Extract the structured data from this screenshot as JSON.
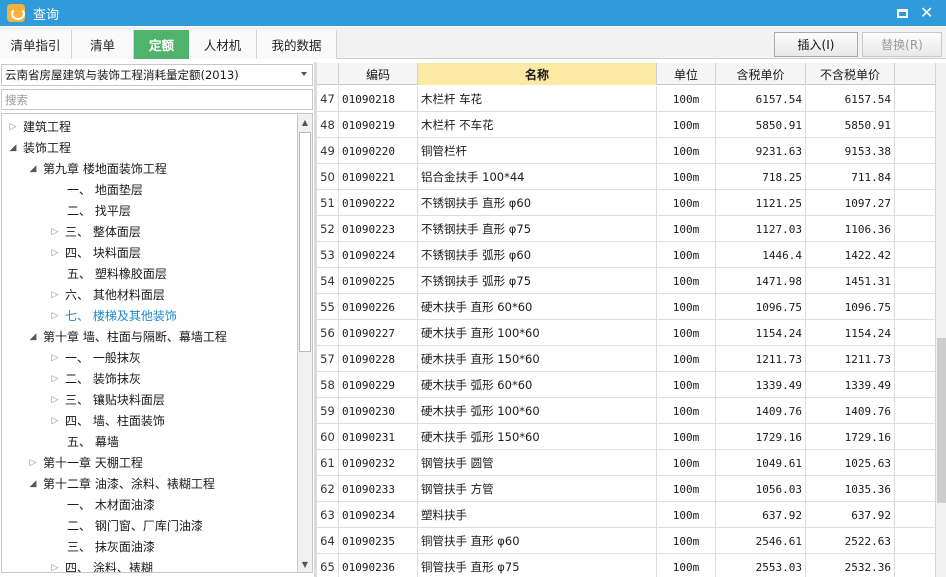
{
  "window": {
    "title": "查询",
    "icon": "app-logo-icon",
    "accent": "#2f9bdb"
  },
  "tabs": [
    {
      "label": "清单指引",
      "active": false
    },
    {
      "label": "清单",
      "active": false
    },
    {
      "label": "定额",
      "active": true
    },
    {
      "label": "人材机",
      "active": false
    },
    {
      "label": "我的数据",
      "active": false
    }
  ],
  "actions": {
    "insert_label": "插入(I)",
    "replace_label": "替换(R)"
  },
  "left": {
    "dropdown_value": "云南省房屋建筑与装饰工程消耗量定额(2013)",
    "search_placeholder": "搜索",
    "tree": [
      {
        "label": "建筑工程",
        "level": 0,
        "caret": "collapsed"
      },
      {
        "label": "装饰工程",
        "level": 0,
        "caret": "expanded"
      },
      {
        "label": "第九章 楼地面装饰工程",
        "level": 1,
        "caret": "expanded"
      },
      {
        "label": "一、 地面垫层",
        "level": 2,
        "caret": "none"
      },
      {
        "label": "二、 找平层",
        "level": 2,
        "caret": "none"
      },
      {
        "label": "三、 整体面层",
        "level": 2,
        "caret": "collapsed"
      },
      {
        "label": "四、 块料面层",
        "level": 2,
        "caret": "collapsed"
      },
      {
        "label": "五、 塑料橡胶面层",
        "level": 2,
        "caret": "none"
      },
      {
        "label": "六、 其他材料面层",
        "level": 2,
        "caret": "collapsed"
      },
      {
        "label": "七、 楼梯及其他装饰",
        "level": 2,
        "caret": "collapsed",
        "selected": true
      },
      {
        "label": "第十章 墙、柱面与隔断、幕墙工程",
        "level": 1,
        "caret": "expanded"
      },
      {
        "label": "一、 一般抹灰",
        "level": 2,
        "caret": "collapsed"
      },
      {
        "label": "二、 装饰抹灰",
        "level": 2,
        "caret": "collapsed"
      },
      {
        "label": "三、 镶贴块料面层",
        "level": 2,
        "caret": "collapsed"
      },
      {
        "label": "四、 墙、柱面装饰",
        "level": 2,
        "caret": "collapsed"
      },
      {
        "label": "五、 幕墙",
        "level": 2,
        "caret": "none"
      },
      {
        "label": "第十一章 天棚工程",
        "level": 1,
        "caret": "collapsed"
      },
      {
        "label": "第十二章 油漆、涂料、裱糊工程",
        "level": 1,
        "caret": "expanded"
      },
      {
        "label": "一、 木材面油漆",
        "level": 2,
        "caret": "none"
      },
      {
        "label": "二、 钢门窗、厂库门油漆",
        "level": 2,
        "caret": "none"
      },
      {
        "label": "三、 抹灰面油漆",
        "level": 2,
        "caret": "none"
      },
      {
        "label": "四、 涂料、裱糊",
        "level": 2,
        "caret": "collapsed"
      }
    ]
  },
  "grid": {
    "headers": {
      "code": "编码",
      "name": "名称",
      "unit": "单位",
      "tax_price": "含税单价",
      "notax_price": "不含税单价"
    },
    "rows": [
      {
        "idx": "47",
        "code": "01090218",
        "name": "木栏杆 车花",
        "unit": "100m",
        "tax": "6157.54",
        "notax": "6157.54"
      },
      {
        "idx": "48",
        "code": "01090219",
        "name": "木栏杆 不车花",
        "unit": "100m",
        "tax": "5850.91",
        "notax": "5850.91"
      },
      {
        "idx": "49",
        "code": "01090220",
        "name": "铜管栏杆",
        "unit": "100m",
        "tax": "9231.63",
        "notax": "9153.38"
      },
      {
        "idx": "50",
        "code": "01090221",
        "name": "铝合金扶手 100*44",
        "unit": "100m",
        "tax": "718.25",
        "notax": "711.84"
      },
      {
        "idx": "51",
        "code": "01090222",
        "name": "不锈钢扶手 直形 φ60",
        "unit": "100m",
        "tax": "1121.25",
        "notax": "1097.27"
      },
      {
        "idx": "52",
        "code": "01090223",
        "name": "不锈钢扶手 直形 φ75",
        "unit": "100m",
        "tax": "1127.03",
        "notax": "1106.36"
      },
      {
        "idx": "53",
        "code": "01090224",
        "name": "不锈钢扶手 弧形 φ60",
        "unit": "100m",
        "tax": "1446.4",
        "notax": "1422.42"
      },
      {
        "idx": "54",
        "code": "01090225",
        "name": "不锈钢扶手 弧形 φ75",
        "unit": "100m",
        "tax": "1471.98",
        "notax": "1451.31"
      },
      {
        "idx": "55",
        "code": "01090226",
        "name": "硬木扶手 直形 60*60",
        "unit": "100m",
        "tax": "1096.75",
        "notax": "1096.75"
      },
      {
        "idx": "56",
        "code": "01090227",
        "name": "硬木扶手 直形 100*60",
        "unit": "100m",
        "tax": "1154.24",
        "notax": "1154.24"
      },
      {
        "idx": "57",
        "code": "01090228",
        "name": "硬木扶手 直形 150*60",
        "unit": "100m",
        "tax": "1211.73",
        "notax": "1211.73"
      },
      {
        "idx": "58",
        "code": "01090229",
        "name": "硬木扶手 弧形 60*60",
        "unit": "100m",
        "tax": "1339.49",
        "notax": "1339.49"
      },
      {
        "idx": "59",
        "code": "01090230",
        "name": "硬木扶手 弧形 100*60",
        "unit": "100m",
        "tax": "1409.76",
        "notax": "1409.76"
      },
      {
        "idx": "60",
        "code": "01090231",
        "name": "硬木扶手 弧形 150*60",
        "unit": "100m",
        "tax": "1729.16",
        "notax": "1729.16"
      },
      {
        "idx": "61",
        "code": "01090232",
        "name": "钢管扶手 圆管",
        "unit": "100m",
        "tax": "1049.61",
        "notax": "1025.63"
      },
      {
        "idx": "62",
        "code": "01090233",
        "name": "钢管扶手 方管",
        "unit": "100m",
        "tax": "1056.03",
        "notax": "1035.36"
      },
      {
        "idx": "63",
        "code": "01090234",
        "name": "塑料扶手",
        "unit": "100m",
        "tax": "637.92",
        "notax": "637.92"
      },
      {
        "idx": "64",
        "code": "01090235",
        "name": "铜管扶手 直形 φ60",
        "unit": "100m",
        "tax": "2546.61",
        "notax": "2522.63"
      },
      {
        "idx": "65",
        "code": "01090236",
        "name": "铜管扶手 直形 φ75",
        "unit": "100m",
        "tax": "2553.03",
        "notax": "2532.36"
      }
    ]
  }
}
